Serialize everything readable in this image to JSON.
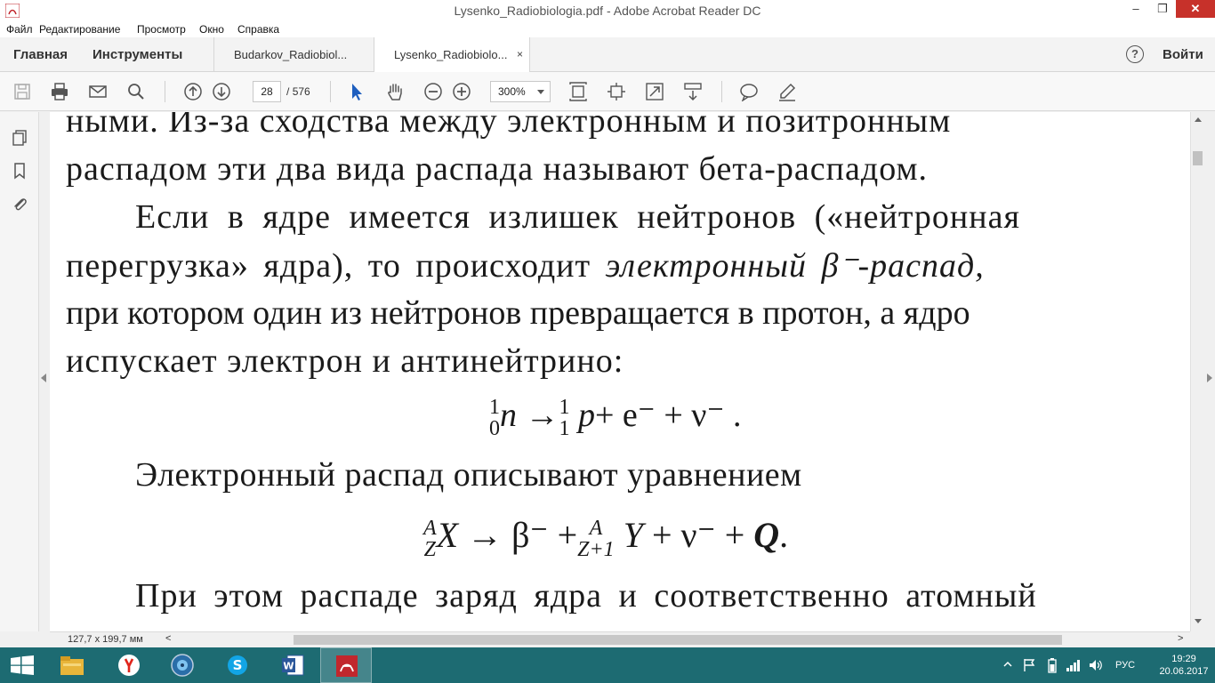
{
  "window": {
    "title": "Lysenko_Radiobiologia.pdf - Adobe Acrobat Reader DC",
    "minimize": "–",
    "maximize": "❐",
    "close": "✕"
  },
  "menu": [
    "Файл",
    "Редактирование",
    "Просмотр",
    "Окно",
    "Справка"
  ],
  "tabs": {
    "home": "Главная",
    "tools": "Инструменты",
    "documents": [
      {
        "label": "Budarkov_Radiobiol...",
        "active": false
      },
      {
        "label": "Lysenko_Radiobiolo...",
        "active": true
      }
    ],
    "close_glyph": "×",
    "help_glyph": "?",
    "signin": "Войти"
  },
  "toolbar": {
    "page_current": "28",
    "page_separator": "/",
    "page_total": "576",
    "zoom": "300%"
  },
  "document": {
    "lines": [
      "ными. Из-за сходства между электронным и позитронным",
      "распадом эти два вида распада называют бета-распадом.",
      "Если в ядре имеется излишек нейтронов («нейтронная",
      "перегрузка» ядра), то происходит",
      "электронный",
      "β⁻-распад,",
      "при котором один из нейтронов превращается в протон, а ядро",
      "испускает электрон и антинейтрино:",
      "Электронный распад описывают уравнением",
      "При этом распаде заряд ядра и соответственно атомный"
    ],
    "formula1": {
      "a_top": "1",
      "a_bot": "0",
      "a_sym": "n",
      "arrow": "→",
      "b_top": "1",
      "b_bot": "1",
      "b_sym": "p",
      "rest": "+ e⁻ + ν⁻ ."
    },
    "formula2": {
      "a_top": "A",
      "a_bot": "Z",
      "a_sym": "X",
      "mid": "→ β⁻ +",
      "b_top": "A",
      "b_bot": "Z+1",
      "b_sym": "Y",
      "rest": "+ ν⁻ +",
      "q": "Q",
      "dot": "."
    }
  },
  "status": {
    "dimensions": "127,7 x 199,7 мм",
    "left_arrow": "<",
    "right_arrow": ">"
  },
  "taskbar": {
    "language": "РУС",
    "time": "19:29",
    "date": "20.06.2017"
  }
}
